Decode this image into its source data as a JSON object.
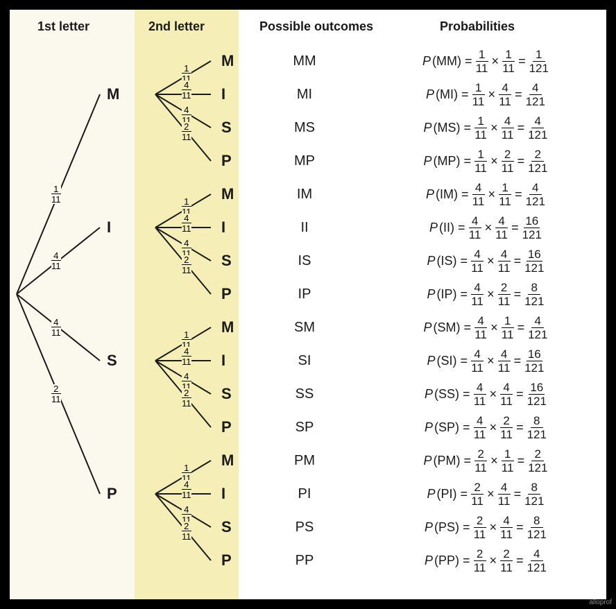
{
  "headers": {
    "col1": "1st letter",
    "col2": "2nd letter",
    "col3": "Possible outcomes",
    "col4": "Probabilities"
  },
  "watermark": "alloprof",
  "letters": [
    "M",
    "I",
    "S",
    "P"
  ],
  "first_probs": {
    "M": {
      "n": "1",
      "d": "11"
    },
    "I": {
      "n": "4",
      "d": "11"
    },
    "S": {
      "n": "4",
      "d": "11"
    },
    "P": {
      "n": "2",
      "d": "11"
    }
  },
  "second_probs": {
    "M": {
      "n": "1",
      "d": "11"
    },
    "I": {
      "n": "4",
      "d": "11"
    },
    "S": {
      "n": "4",
      "d": "11"
    },
    "P": {
      "n": "2",
      "d": "11"
    }
  },
  "outcomes": [
    {
      "code": "MM",
      "p1": {
        "n": "1",
        "d": "11"
      },
      "p2": {
        "n": "1",
        "d": "11"
      },
      "res": {
        "n": "1",
        "d": "121"
      }
    },
    {
      "code": "MI",
      "p1": {
        "n": "1",
        "d": "11"
      },
      "p2": {
        "n": "4",
        "d": "11"
      },
      "res": {
        "n": "4",
        "d": "121"
      }
    },
    {
      "code": "MS",
      "p1": {
        "n": "1",
        "d": "11"
      },
      "p2": {
        "n": "4",
        "d": "11"
      },
      "res": {
        "n": "4",
        "d": "121"
      }
    },
    {
      "code": "MP",
      "p1": {
        "n": "1",
        "d": "11"
      },
      "p2": {
        "n": "2",
        "d": "11"
      },
      "res": {
        "n": "2",
        "d": "121"
      }
    },
    {
      "code": "IM",
      "p1": {
        "n": "4",
        "d": "11"
      },
      "p2": {
        "n": "1",
        "d": "11"
      },
      "res": {
        "n": "4",
        "d": "121"
      }
    },
    {
      "code": "II",
      "p1": {
        "n": "4",
        "d": "11"
      },
      "p2": {
        "n": "4",
        "d": "11"
      },
      "res": {
        "n": "16",
        "d": "121"
      }
    },
    {
      "code": "IS",
      "p1": {
        "n": "4",
        "d": "11"
      },
      "p2": {
        "n": "4",
        "d": "11"
      },
      "res": {
        "n": "16",
        "d": "121"
      }
    },
    {
      "code": "IP",
      "p1": {
        "n": "4",
        "d": "11"
      },
      "p2": {
        "n": "2",
        "d": "11"
      },
      "res": {
        "n": "8",
        "d": "121"
      }
    },
    {
      "code": "SM",
      "p1": {
        "n": "4",
        "d": "11"
      },
      "p2": {
        "n": "1",
        "d": "11"
      },
      "res": {
        "n": "4",
        "d": "121"
      }
    },
    {
      "code": "SI",
      "p1": {
        "n": "4",
        "d": "11"
      },
      "p2": {
        "n": "4",
        "d": "11"
      },
      "res": {
        "n": "16",
        "d": "121"
      }
    },
    {
      "code": "SS",
      "p1": {
        "n": "4",
        "d": "11"
      },
      "p2": {
        "n": "4",
        "d": "11"
      },
      "res": {
        "n": "16",
        "d": "121"
      }
    },
    {
      "code": "SP",
      "p1": {
        "n": "4",
        "d": "11"
      },
      "p2": {
        "n": "2",
        "d": "11"
      },
      "res": {
        "n": "8",
        "d": "121"
      }
    },
    {
      "code": "PM",
      "p1": {
        "n": "2",
        "d": "11"
      },
      "p2": {
        "n": "1",
        "d": "11"
      },
      "res": {
        "n": "2",
        "d": "121"
      }
    },
    {
      "code": "PI",
      "p1": {
        "n": "2",
        "d": "11"
      },
      "p2": {
        "n": "4",
        "d": "11"
      },
      "res": {
        "n": "8",
        "d": "121"
      }
    },
    {
      "code": "PS",
      "p1": {
        "n": "2",
        "d": "11"
      },
      "p2": {
        "n": "4",
        "d": "11"
      },
      "res": {
        "n": "8",
        "d": "121"
      }
    },
    {
      "code": "PP",
      "p1": {
        "n": "2",
        "d": "11"
      },
      "p2": {
        "n": "2",
        "d": "11"
      },
      "res": {
        "n": "4",
        "d": "121"
      }
    }
  ],
  "chart_data": {
    "type": "table",
    "title": "Probability tree diagram for drawing two letters with replacement from MISSISSIPPI",
    "first_level_probabilities": {
      "M": "1/11",
      "I": "4/11",
      "S": "4/11",
      "P": "2/11"
    },
    "second_level_probabilities": {
      "M": "1/11",
      "I": "4/11",
      "S": "4/11",
      "P": "2/11"
    },
    "rows": [
      {
        "outcome": "MM",
        "probability": "1/121"
      },
      {
        "outcome": "MI",
        "probability": "4/121"
      },
      {
        "outcome": "MS",
        "probability": "4/121"
      },
      {
        "outcome": "MP",
        "probability": "2/121"
      },
      {
        "outcome": "IM",
        "probability": "4/121"
      },
      {
        "outcome": "II",
        "probability": "16/121"
      },
      {
        "outcome": "IS",
        "probability": "16/121"
      },
      {
        "outcome": "IP",
        "probability": "8/121"
      },
      {
        "outcome": "SM",
        "probability": "4/121"
      },
      {
        "outcome": "SI",
        "probability": "16/121"
      },
      {
        "outcome": "SS",
        "probability": "16/121"
      },
      {
        "outcome": "SP",
        "probability": "8/121"
      },
      {
        "outcome": "PM",
        "probability": "2/121"
      },
      {
        "outcome": "PI",
        "probability": "8/121"
      },
      {
        "outcome": "PS",
        "probability": "8/121"
      },
      {
        "outcome": "PP",
        "probability": "4/121"
      }
    ]
  }
}
